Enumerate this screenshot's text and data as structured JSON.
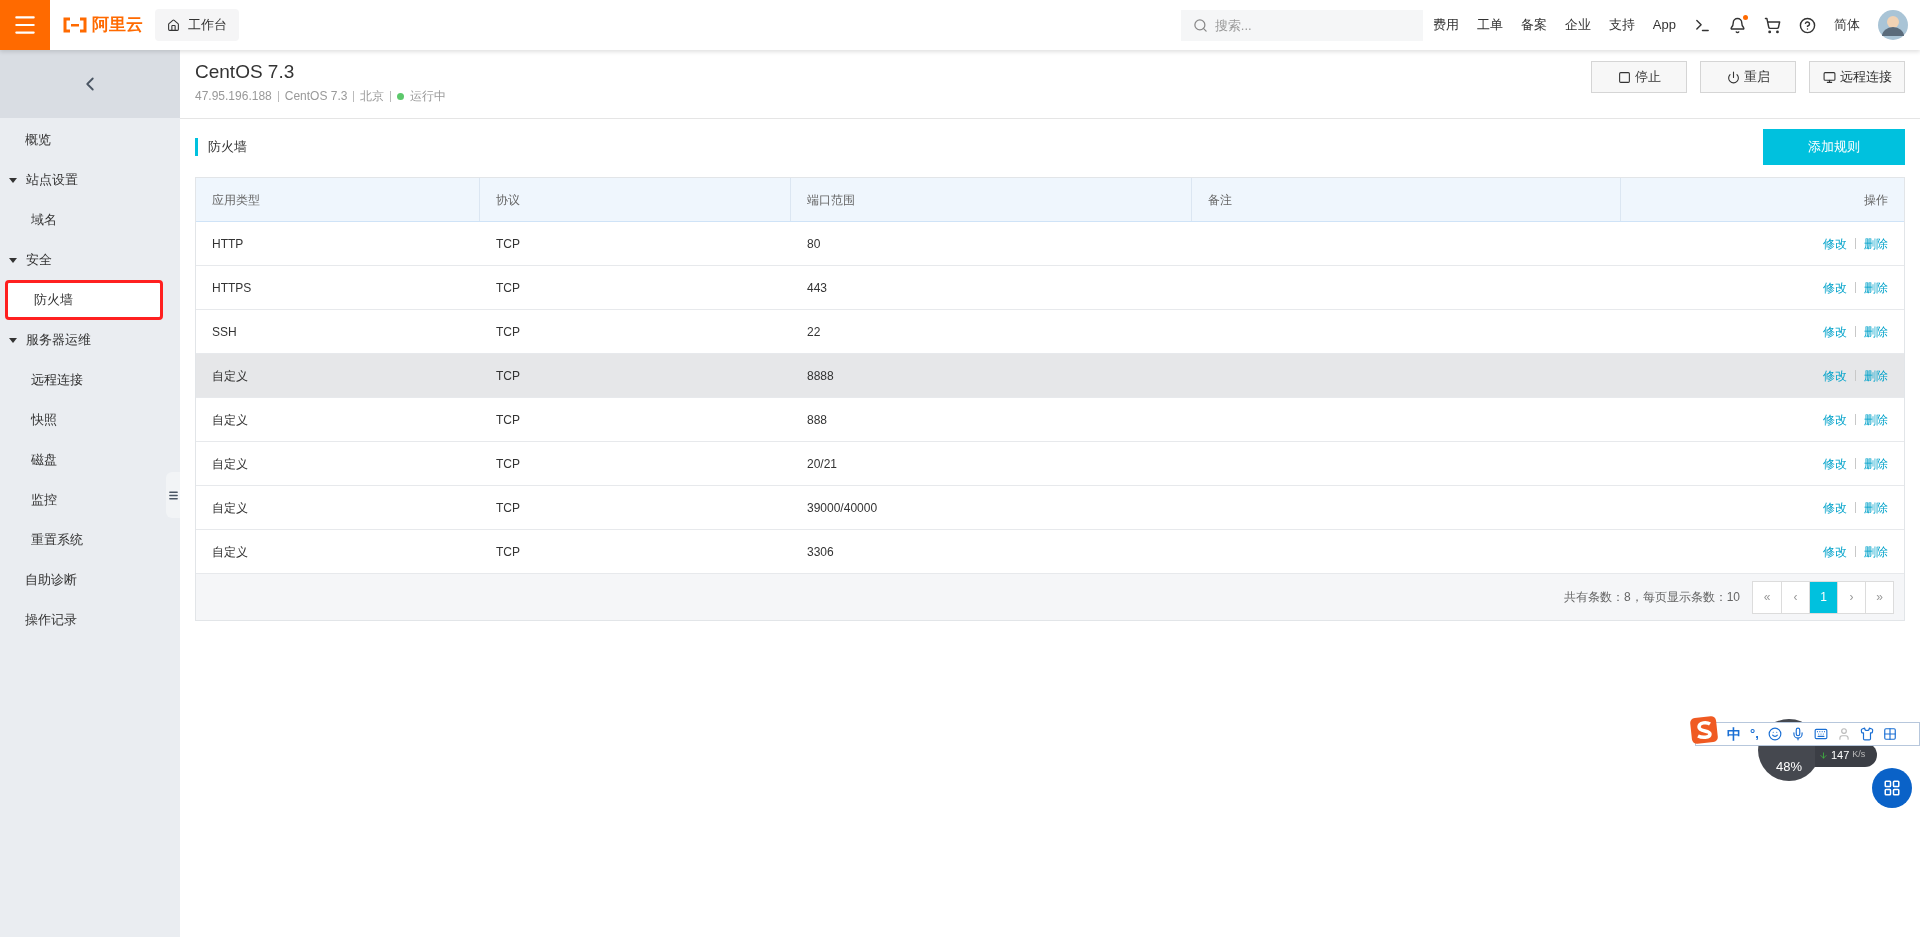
{
  "topbar": {
    "logo": "阿里云",
    "workbench": "工作台",
    "search": {
      "placeholder": "搜索..."
    },
    "links": [
      "费用",
      "工单",
      "备案",
      "企业",
      "支持",
      "App"
    ],
    "has_unread": true,
    "language": "简体"
  },
  "sidebar": {
    "items": [
      {
        "kind": "item",
        "label": "概览",
        "selected": false
      },
      {
        "kind": "section",
        "label": "站点设置",
        "expanded": true,
        "children": [
          {
            "kind": "item",
            "label": "域名",
            "selected": false
          }
        ]
      },
      {
        "kind": "section",
        "label": "安全",
        "expanded": true,
        "children": [
          {
            "kind": "item",
            "label": "防火墙",
            "selected": true
          }
        ]
      },
      {
        "kind": "section",
        "label": "服务器运维",
        "expanded": true,
        "children": [
          {
            "kind": "item",
            "label": "远程连接",
            "selected": false
          },
          {
            "kind": "item",
            "label": "快照",
            "selected": false
          },
          {
            "kind": "item",
            "label": "磁盘",
            "selected": false
          },
          {
            "kind": "item",
            "label": "监控",
            "selected": false
          },
          {
            "kind": "item",
            "label": "重置系统",
            "selected": false
          }
        ]
      },
      {
        "kind": "item",
        "label": "自助诊断",
        "selected": false
      },
      {
        "kind": "item",
        "label": "操作记录",
        "selected": false
      }
    ]
  },
  "header": {
    "title": "CentOS 7.3",
    "meta": [
      "47.95.196.188",
      "CentOS 7.3",
      "北京"
    ],
    "status": {
      "label": "运行中",
      "running": true
    },
    "actions": [
      {
        "kind": "stop",
        "label": "停止"
      },
      {
        "kind": "restart",
        "label": "重启"
      },
      {
        "kind": "remote",
        "label": "远程连接"
      }
    ]
  },
  "section": {
    "title": "防火墙",
    "add_button": "添加规则"
  },
  "table": {
    "columns": [
      "应用类型",
      "协议",
      "端口范围",
      "备注",
      "操作"
    ],
    "rows": [
      {
        "cells": [
          "HTTP",
          "TCP",
          "80",
          ""
        ],
        "highlighted": false,
        "actions": [
          "修改",
          "删除"
        ]
      },
      {
        "cells": [
          "HTTPS",
          "TCP",
          "443",
          ""
        ],
        "highlighted": false,
        "actions": [
          "修改",
          "删除"
        ]
      },
      {
        "cells": [
          "SSH",
          "TCP",
          "22",
          ""
        ],
        "highlighted": false,
        "actions": [
          "修改",
          "删除"
        ]
      },
      {
        "cells": [
          "自定义",
          "TCP",
          "8888",
          ""
        ],
        "highlighted": true,
        "actions": [
          "修改",
          "删除"
        ]
      },
      {
        "cells": [
          "自定义",
          "TCP",
          "888",
          ""
        ],
        "highlighted": false,
        "actions": [
          "修改",
          "删除"
        ]
      },
      {
        "cells": [
          "自定义",
          "TCP",
          "20/21",
          ""
        ],
        "highlighted": false,
        "actions": [
          "修改",
          "删除"
        ]
      },
      {
        "cells": [
          "自定义",
          "TCP",
          "39000/40000",
          ""
        ],
        "highlighted": false,
        "actions": [
          "修改",
          "删除"
        ]
      },
      {
        "cells": [
          "自定义",
          "TCP",
          "3306",
          ""
        ],
        "highlighted": false,
        "actions": [
          "修改",
          "删除"
        ]
      }
    ]
  },
  "pagination": {
    "summary": "共有条数：8，每页显示条数：10",
    "pages": [
      {
        "label": "«",
        "selected": false
      },
      {
        "label": "‹",
        "selected": false
      },
      {
        "label": "1",
        "selected": true
      },
      {
        "label": "›",
        "selected": false
      },
      {
        "label": "»",
        "selected": false
      }
    ]
  },
  "ime_bar": {
    "mode": "中",
    "punct": "°,"
  },
  "speed_widget": {
    "percent": "48%",
    "speed": "147",
    "unit": "K/s"
  }
}
